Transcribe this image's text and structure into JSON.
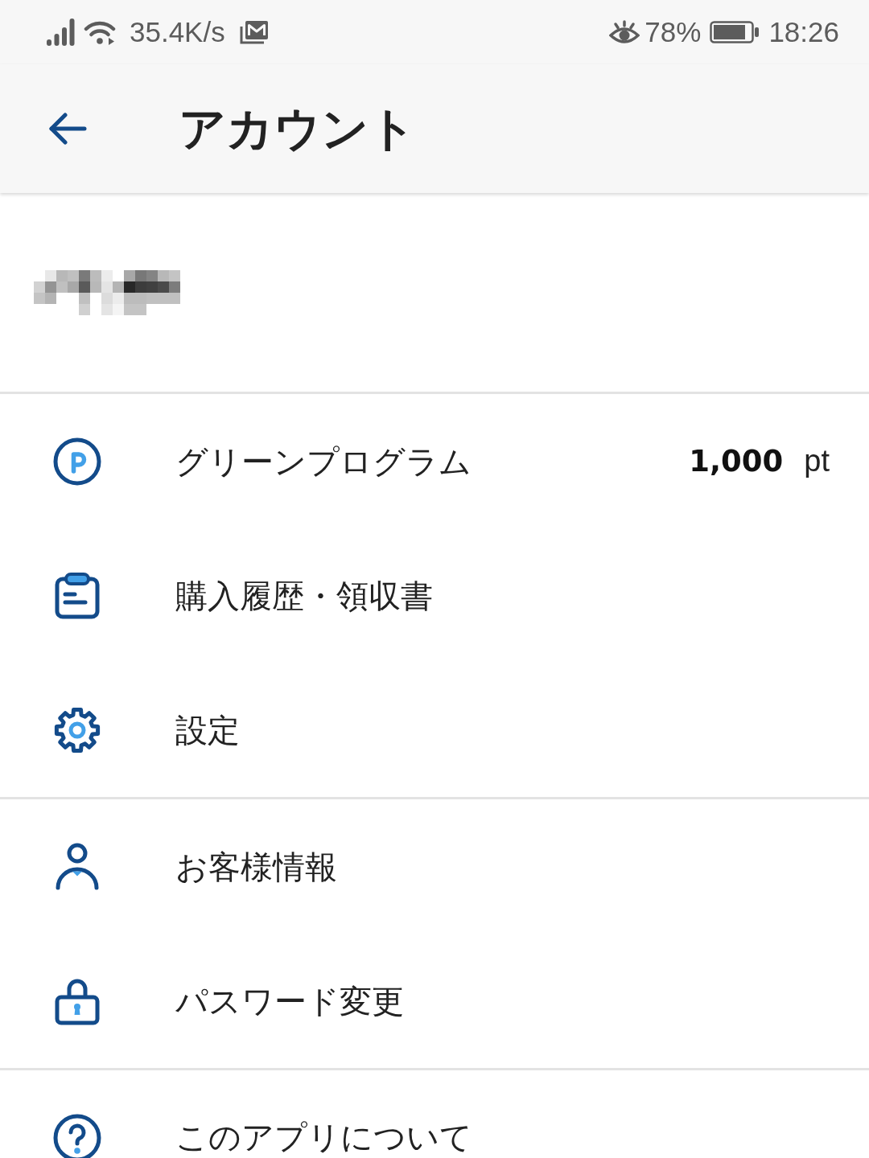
{
  "status_bar": {
    "network_speed": "35.4K/s",
    "battery_percent": "78%",
    "time": "18:26"
  },
  "app_bar": {
    "title": "アカウント"
  },
  "menu_sections": [
    {
      "items": [
        {
          "kind": "points",
          "label": "グリーンプログラム",
          "points": {
            "value": "1,000",
            "unit": "pt"
          }
        },
        {
          "kind": "history",
          "label": "購入履歴・領収書"
        },
        {
          "kind": "settings",
          "label": "設定"
        }
      ]
    },
    {
      "items": [
        {
          "kind": "profile",
          "label": "お客様情報"
        },
        {
          "kind": "password",
          "label": "パスワード変更"
        }
      ]
    },
    {
      "items": [
        {
          "kind": "about",
          "label": "このアプリについて"
        }
      ]
    }
  ]
}
